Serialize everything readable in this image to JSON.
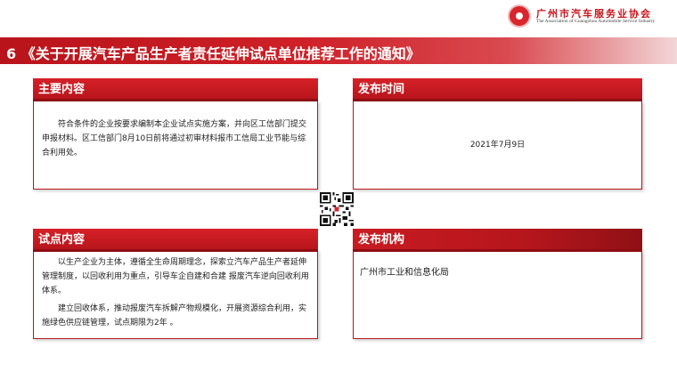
{
  "header": {
    "org_name_cn": "广州市汽车服务业协会",
    "org_name_en": "The Association of Guangzhou Automobile Service Industry",
    "title": "6 《关于开展汽车产品生产者责任延伸试点单位推荐工作的通知》"
  },
  "panels": {
    "main_content": {
      "heading": "主要内容",
      "paragraphs": [
        "符合条件的企业按要求编制本企业试点实施方案，并向区工信部门提交申报材料。区工信部门8月10日前将通过初审材料报市工信局工业节能与综合利用处。"
      ]
    },
    "publish_time": {
      "heading": "发布时间",
      "value": "2021年7月9日"
    },
    "pilot_content": {
      "heading": "试点内容",
      "paragraphs": [
        "以生产企业为主体，遵循全生命周期理念，探索立汽车产品生产者延伸管理制度，以回收利用为重点，引导车企自建和合建 报废汽车逆向回收利用体系。",
        "建立回收体系，推动报废汽车拆解产物规模化，开展资源综合利用，实施绿色供应链管理，试点期限为2年 。"
      ]
    },
    "publisher": {
      "heading": "发布机构",
      "value": "广州市工业和信息化局"
    }
  },
  "colors": {
    "brand_red": "#c8161d",
    "dark_red": "#8e0d13"
  },
  "icons": {
    "logo": "association-emblem-icon",
    "qr": "qr-code-icon"
  }
}
